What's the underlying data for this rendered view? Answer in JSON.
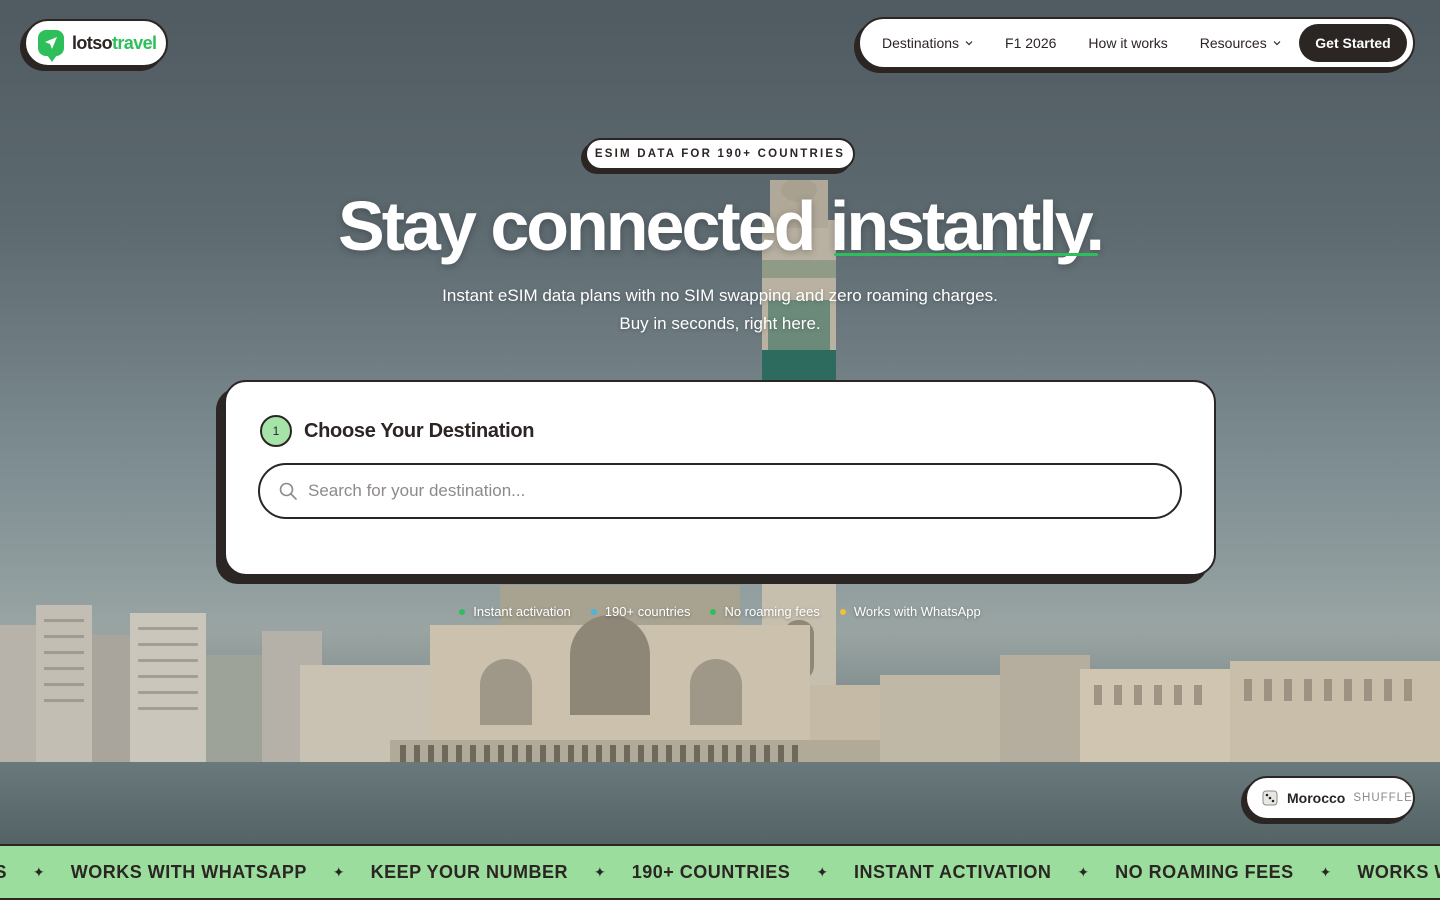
{
  "brand": {
    "name_part1": "lotso",
    "name_part2": "travel"
  },
  "nav": {
    "items": [
      {
        "label": "Destinations",
        "has_dropdown": true
      },
      {
        "label": "F1 2026",
        "has_dropdown": false
      },
      {
        "label": "How it works",
        "has_dropdown": false
      },
      {
        "label": "Resources",
        "has_dropdown": true
      }
    ],
    "cta_label": "Get Started"
  },
  "hero": {
    "badge": "ESIM DATA FOR 190+ COUNTRIES",
    "headline_part1": "Stay connected",
    "headline_part2": "instantly.",
    "subline1": "Instant eSIM data plans with no SIM swapping and zero roaming charges.",
    "subline2": "Buy in seconds, right here."
  },
  "search_card": {
    "step_number": "1",
    "title": "Choose Your Destination",
    "placeholder": "Search for your destination..."
  },
  "features": [
    {
      "label": "Instant activation",
      "dot_color": "#2fbf5a"
    },
    {
      "label": "190+ countries",
      "dot_color": "#4fb3e0"
    },
    {
      "label": "No roaming fees",
      "dot_color": "#2fbf5a"
    },
    {
      "label": "Works with WhatsApp",
      "dot_color": "#f2c230"
    }
  ],
  "shuffle": {
    "country": "Morocco",
    "label": "SHUFFLE"
  },
  "marquee": {
    "items": [
      "ES",
      "WORKS WITH WHATSAPP",
      "KEEP YOUR NUMBER",
      "190+ COUNTRIES",
      "INSTANT ACTIVATION",
      "NO ROAMING FEES",
      "WORKS WITH W"
    ],
    "separator": "✦"
  },
  "colors": {
    "accent_green": "#2fbf5a",
    "ink": "#2b2523",
    "marquee_bg": "#9bdd9d"
  }
}
